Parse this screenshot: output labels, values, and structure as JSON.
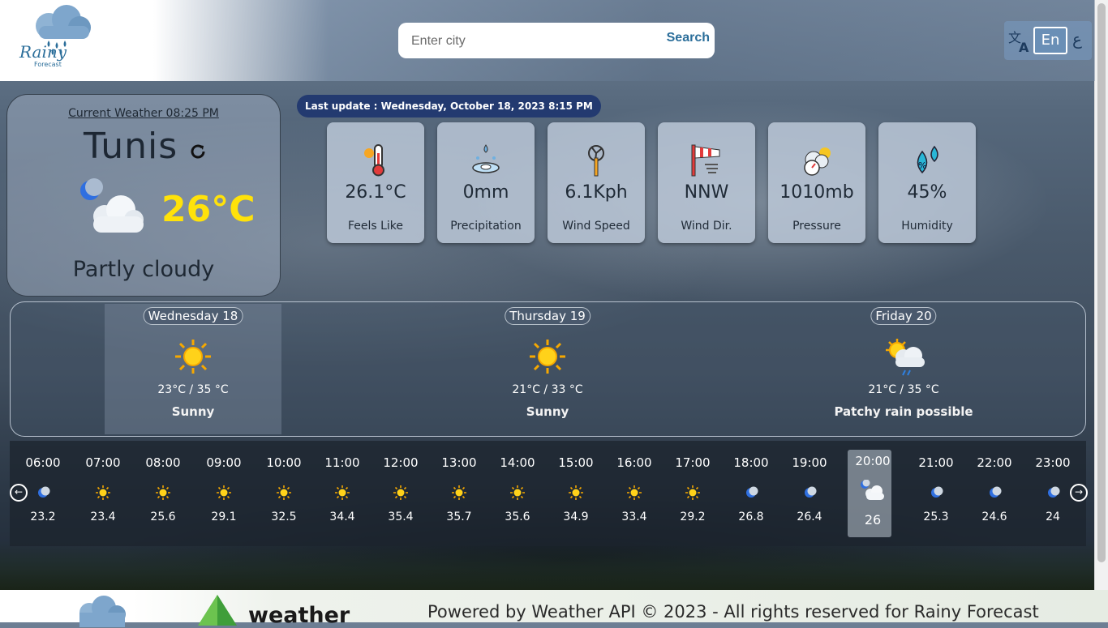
{
  "header": {
    "logo_text": "Rainy",
    "logo_sub": "Forecast",
    "search_placeholder": "Enter city",
    "search_value": "",
    "search_label": "Search",
    "lang_en": "En",
    "lang_ar": "ع"
  },
  "current": {
    "title": "Current Weather 08:25 PM",
    "city": "Tunis",
    "temp": "26°C",
    "condition": "Partly cloudy",
    "icon": "partly-cloudy-night-icon"
  },
  "last_update": "Last update : Wednesday, October 18, 2023 8:15 PM",
  "stats": [
    {
      "value": "26.1°C",
      "label": "Feels Like",
      "icon": "thermometer-icon"
    },
    {
      "value": "0mm",
      "label": "Precipitation",
      "icon": "precipitation-icon"
    },
    {
      "value": "6.1Kph",
      "label": "Wind Speed",
      "icon": "wind-turbine-icon"
    },
    {
      "value": "NNW",
      "label": "Wind Dir.",
      "icon": "windsock-icon"
    },
    {
      "value": "1010mb",
      "label": "Pressure",
      "icon": "pressure-gauge-icon"
    },
    {
      "value": "45%",
      "label": "Humidity",
      "icon": "humidity-drops-icon"
    }
  ],
  "forecast": [
    {
      "day": "Wednesday 18",
      "range": "23°C / 35 °C",
      "condition": "Sunny",
      "icon": "sun-icon"
    },
    {
      "day": "Thursday 19",
      "range": "21°C / 33 °C",
      "condition": "Sunny",
      "icon": "sun-icon"
    },
    {
      "day": "Friday 20",
      "range": "21°C / 35 °C",
      "condition": "Patchy rain possible",
      "icon": "sun-cloud-rain-icon"
    }
  ],
  "hourly": [
    {
      "time": "06:00",
      "value": "23.2",
      "icon": "moon-icon"
    },
    {
      "time": "07:00",
      "value": "23.4",
      "icon": "sun-icon"
    },
    {
      "time": "08:00",
      "value": "25.6",
      "icon": "sun-icon"
    },
    {
      "time": "09:00",
      "value": "29.1",
      "icon": "sun-icon"
    },
    {
      "time": "10:00",
      "value": "32.5",
      "icon": "sun-icon"
    },
    {
      "time": "11:00",
      "value": "34.4",
      "icon": "sun-icon"
    },
    {
      "time": "12:00",
      "value": "35.4",
      "icon": "sun-icon"
    },
    {
      "time": "13:00",
      "value": "35.7",
      "icon": "sun-icon"
    },
    {
      "time": "14:00",
      "value": "35.6",
      "icon": "sun-icon"
    },
    {
      "time": "15:00",
      "value": "34.9",
      "icon": "sun-icon"
    },
    {
      "time": "16:00",
      "value": "33.4",
      "icon": "sun-icon"
    },
    {
      "time": "17:00",
      "value": "29.2",
      "icon": "sun-icon"
    },
    {
      "time": "18:00",
      "value": "26.8",
      "icon": "moon-icon"
    },
    {
      "time": "19:00",
      "value": "26.4",
      "icon": "moon-icon"
    },
    {
      "time": "20:00",
      "value": "26",
      "icon": "partly-cloudy-night-icon"
    },
    {
      "time": "21:00",
      "value": "25.3",
      "icon": "moon-icon"
    },
    {
      "time": "22:00",
      "value": "24.6",
      "icon": "moon-icon"
    },
    {
      "time": "23:00",
      "value": "24",
      "icon": "moon-icon"
    }
  ],
  "footer": {
    "brand": "weather",
    "text": "Powered by Weather API © 2023 - All rights reserved for Rainy Forecast"
  },
  "colors": {
    "accent": "#2b6e9a",
    "temp": "#ffe20a",
    "badge": "#233a70"
  }
}
